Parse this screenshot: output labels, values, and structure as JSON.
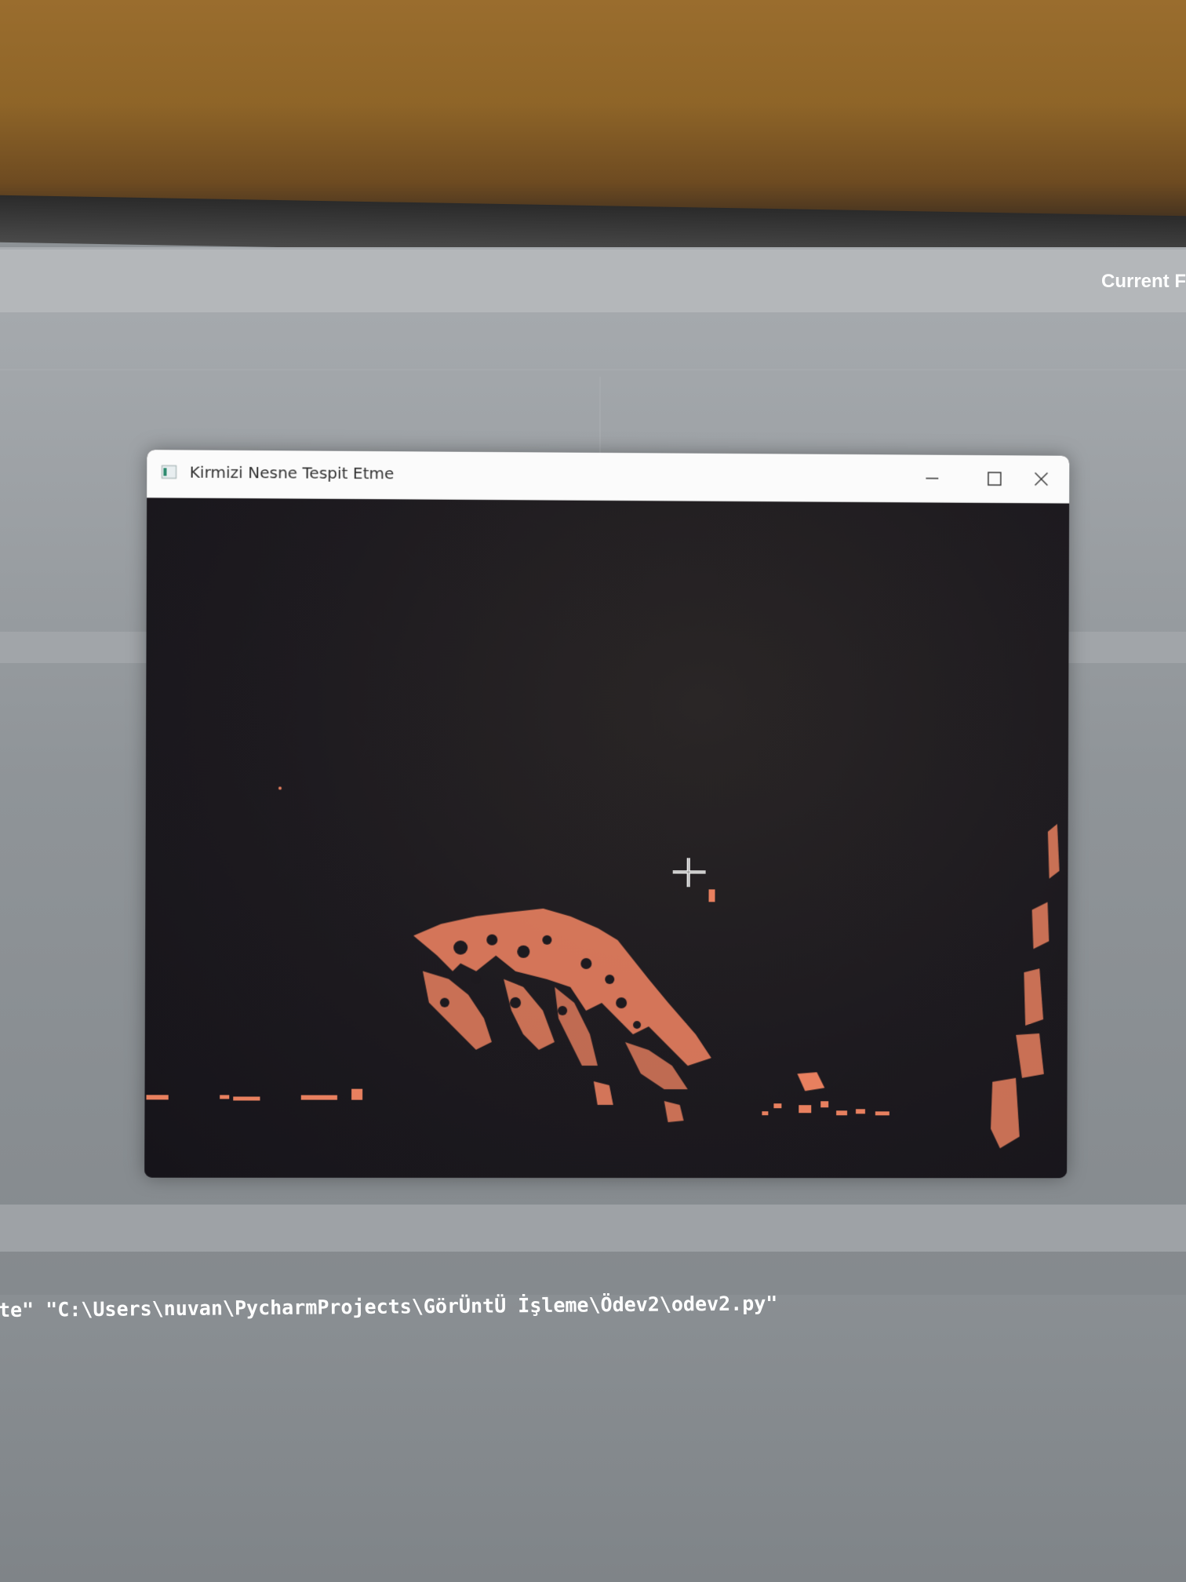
{
  "screen": {
    "top_bar_label": "Current F"
  },
  "window": {
    "title": "Kirmizi Nesne Tespit Etme",
    "controls": [
      "minimize",
      "maximize",
      "close"
    ]
  },
  "terminal": {
    "command_line": "te\" \"C:\\Users\\nuvan\\PycharmProjects\\GörÜntÜ İşleme\\Ödev2\\odev2.py\""
  },
  "colors": {
    "detected_red": "#e8805f",
    "mask_background": "#1d1a1f",
    "titlebar": "#fbfbfb"
  },
  "icons": {
    "app": "window-app-icon",
    "cursor": "crosshair-cursor-icon"
  }
}
